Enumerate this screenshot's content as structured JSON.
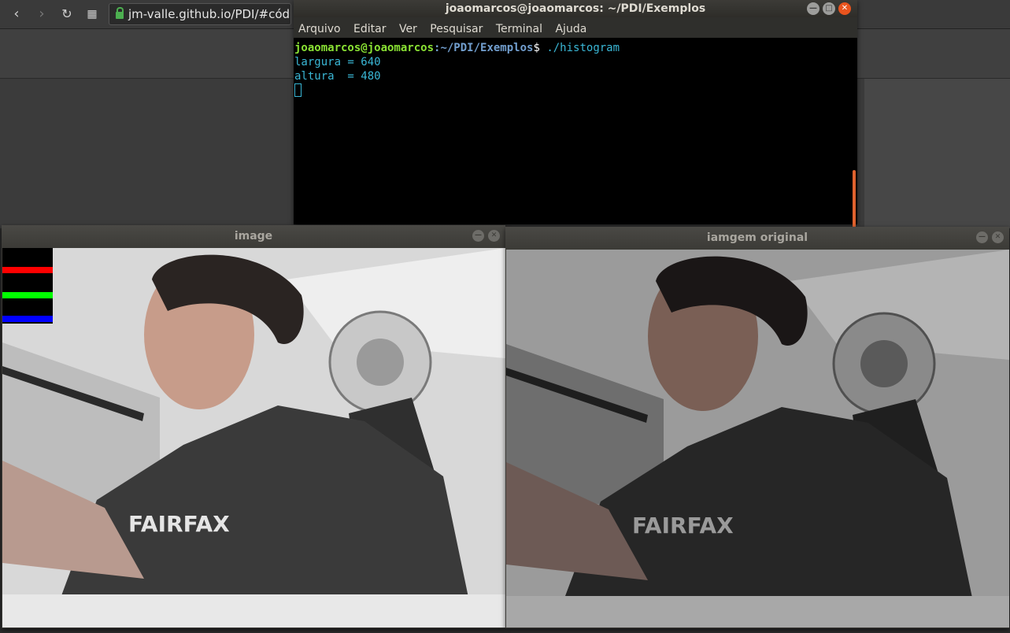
{
  "browser": {
    "url": "jm-valle.github.io/PDI/#códi",
    "nav_icons": [
      "back-icon",
      "forward-icon",
      "reload-icon",
      "apps-grid-icon"
    ]
  },
  "terminal": {
    "title": "joaomarcos@joaomarcos: ~/PDI/Exemplos",
    "menu": [
      "Arquivo",
      "Editar",
      "Ver",
      "Pesquisar",
      "Terminal",
      "Ajuda"
    ],
    "prompt_user": "joaomarcos@joaomarcos",
    "prompt_path": ":~/PDI/Exemplos",
    "prompt_symbol": "$ ",
    "command": "./histogram",
    "output": [
      "largura = 640",
      "altura  = 480"
    ],
    "colors": {
      "user": "#8ae234",
      "path": "#729fcf",
      "text": "#3ab7d6",
      "scrollbar": "#e0622e"
    }
  },
  "windows": {
    "left_title": "image",
    "right_title": "iamgem original"
  },
  "photo_text": "FAIRFAX",
  "histogram": {
    "channels": [
      "red",
      "green",
      "blue"
    ],
    "colors": [
      "#ff0000",
      "#00ff00",
      "#0000ff"
    ]
  }
}
